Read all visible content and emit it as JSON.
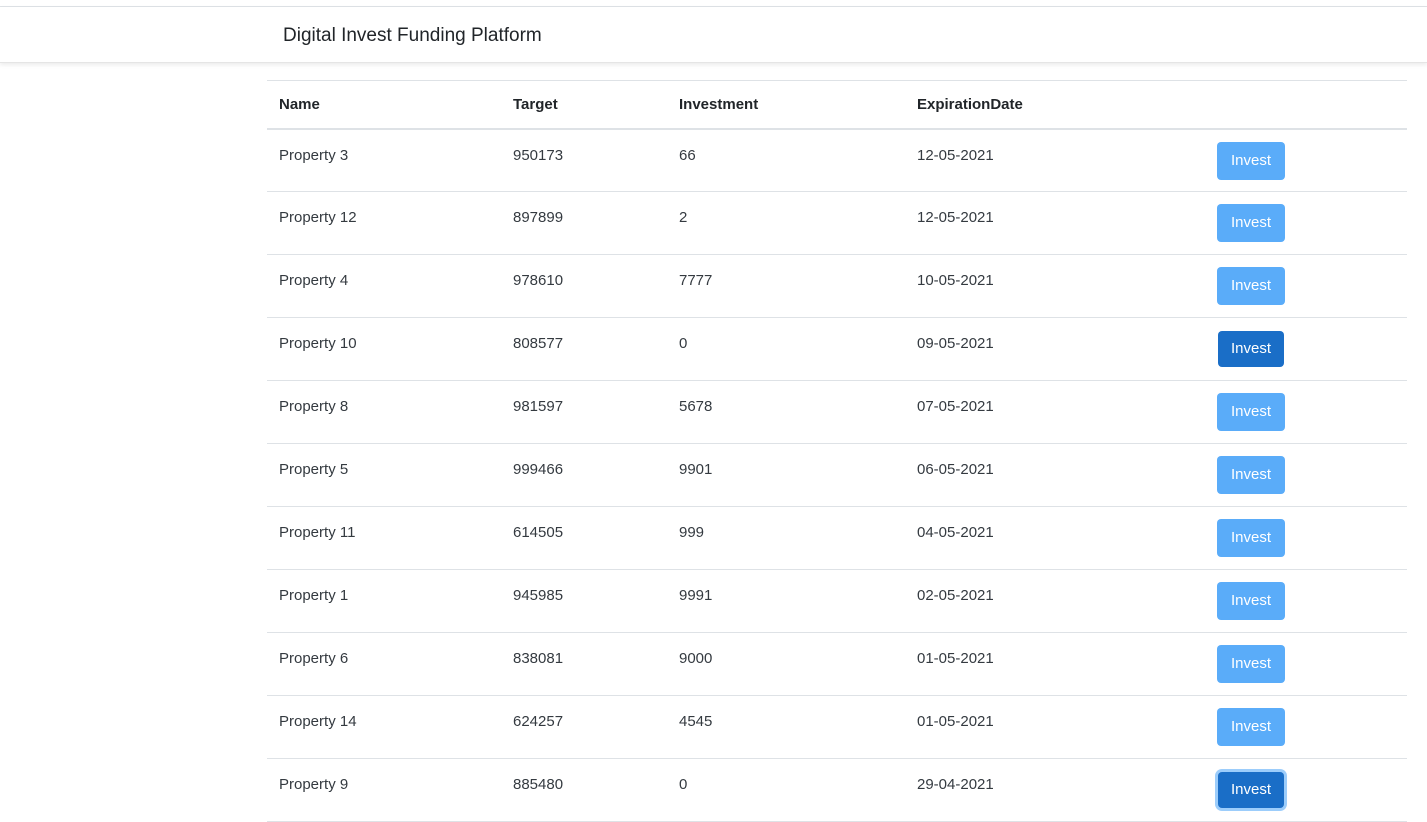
{
  "header": {
    "brand": "Digital Invest Funding Platform"
  },
  "table": {
    "columns": [
      "Name",
      "Target",
      "Investment",
      "ExpirationDate",
      ""
    ],
    "rows": [
      {
        "name": "Property 3",
        "target": "950173",
        "investment": "66",
        "expiration": "12-05-2021",
        "action": "Invest",
        "state": "normal"
      },
      {
        "name": "Property 12",
        "target": "897899",
        "investment": "2",
        "expiration": "12-05-2021",
        "action": "Invest",
        "state": "normal"
      },
      {
        "name": "Property 4",
        "target": "978610",
        "investment": "7777",
        "expiration": "10-05-2021",
        "action": "Invest",
        "state": "normal"
      },
      {
        "name": "Property 10",
        "target": "808577",
        "investment": "0",
        "expiration": "09-05-2021",
        "action": "Invest",
        "state": "active"
      },
      {
        "name": "Property 8",
        "target": "981597",
        "investment": "5678",
        "expiration": "07-05-2021",
        "action": "Invest",
        "state": "normal"
      },
      {
        "name": "Property 5",
        "target": "999466",
        "investment": "9901",
        "expiration": "06-05-2021",
        "action": "Invest",
        "state": "normal"
      },
      {
        "name": "Property 11",
        "target": "614505",
        "investment": "999",
        "expiration": "04-05-2021",
        "action": "Invest",
        "state": "normal"
      },
      {
        "name": "Property 1",
        "target": "945985",
        "investment": "9991",
        "expiration": "02-05-2021",
        "action": "Invest",
        "state": "normal"
      },
      {
        "name": "Property 6",
        "target": "838081",
        "investment": "9000",
        "expiration": "01-05-2021",
        "action": "Invest",
        "state": "normal"
      },
      {
        "name": "Property 14",
        "target": "624257",
        "investment": "4545",
        "expiration": "01-05-2021",
        "action": "Invest",
        "state": "normal"
      },
      {
        "name": "Property 9",
        "target": "885480",
        "investment": "0",
        "expiration": "29-04-2021",
        "action": "Invest",
        "state": "focused"
      }
    ]
  },
  "colors": {
    "button": "#5aacf9",
    "button_active": "#1a6ec7",
    "border": "#dee2e6"
  }
}
